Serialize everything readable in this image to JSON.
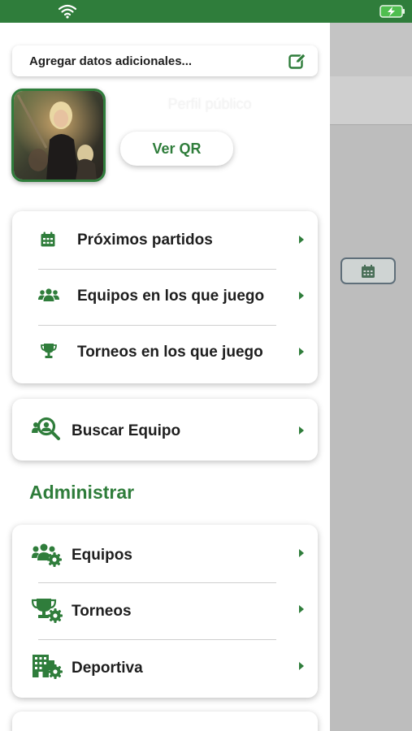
{
  "status_bar": {
    "wifi_icon": "wifi-icon",
    "battery_icon": "battery-charging-icon"
  },
  "profile": {
    "additional_data_label": "Agregar datos adicionales...",
    "edit_icon": "edit-icon",
    "public_profile_label": "Perfil público",
    "qr_button_label": "Ver QR"
  },
  "menu": {
    "items": [
      {
        "label": "Próximos partidos",
        "icon": "calendar-icon"
      },
      {
        "label": "Equipos en los que juego",
        "icon": "users-icon"
      },
      {
        "label": "Torneos en los que juego",
        "icon": "trophy-icon"
      }
    ],
    "search_team_label": "Buscar Equipo"
  },
  "admin": {
    "title": "Administrar",
    "items": [
      {
        "label": "Equipos",
        "icon": "users-gear-icon"
      },
      {
        "label": "Torneos",
        "icon": "trophy-gear-icon"
      },
      {
        "label": "Deportiva",
        "icon": "building-gear-icon"
      }
    ]
  },
  "colors": {
    "brand_green": "#2f7d3b",
    "backdrop": "#b9b9b9"
  }
}
